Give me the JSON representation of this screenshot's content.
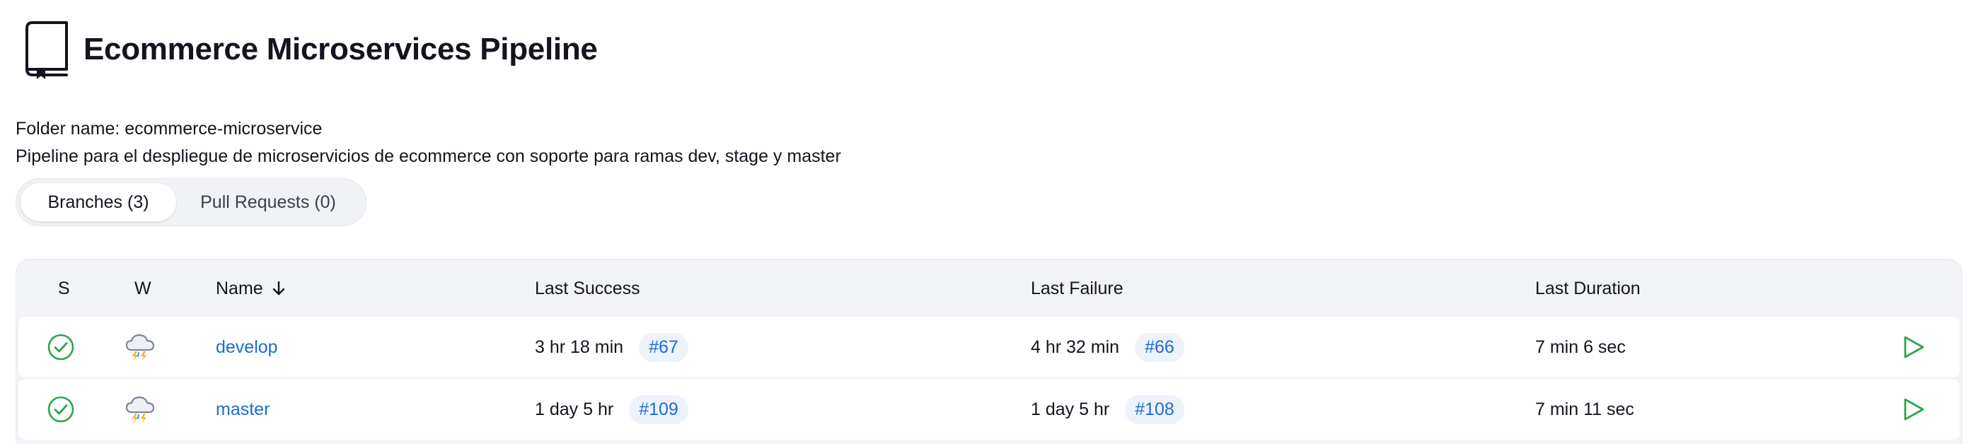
{
  "page": {
    "title": "Ecommerce Microservices Pipeline",
    "folder_name": "Folder name: ecommerce-microservice",
    "description": "Pipeline para el despliegue de microservicios de ecommerce con soporte para ramas dev, stage y master",
    "icon": "folder-book-icon"
  },
  "tabs": [
    {
      "label": "Branches (3)",
      "active": true
    },
    {
      "label": "Pull Requests (0)",
      "active": false
    }
  ],
  "table": {
    "headers": {
      "status": "S",
      "weather": "W",
      "name": "Name",
      "last_success": "Last Success",
      "last_failure": "Last Failure",
      "last_duration": "Last Duration"
    },
    "sort": {
      "column": "Name",
      "direction": "descending",
      "icon": "arrow-down-icon"
    },
    "rows": [
      {
        "name": "develop",
        "status_icon": "success-check-icon",
        "weather_icon": "thunderstorm-icon",
        "last_success": "3 hr 18 min",
        "last_success_build": "#67",
        "last_failure": "4 hr 32 min",
        "last_failure_build": "#66",
        "last_duration": "7 min 6 sec",
        "action_icon": "play-icon"
      },
      {
        "name": "master",
        "status_icon": "success-check-icon",
        "weather_icon": "thunderstorm-icon",
        "last_success": "1 day 5 hr",
        "last_success_build": "#109",
        "last_failure": "1 day 5 hr",
        "last_failure_build": "#108",
        "last_duration": "7 min 11 sec",
        "action_icon": "play-icon"
      }
    ]
  },
  "colors": {
    "success": "#2ea44f",
    "link": "#1c6dd0",
    "badge_bg": "#eef2fb",
    "table_bg": "#f2f3f6",
    "cloud": "#7d8799",
    "lightning": "#f2b33d"
  }
}
